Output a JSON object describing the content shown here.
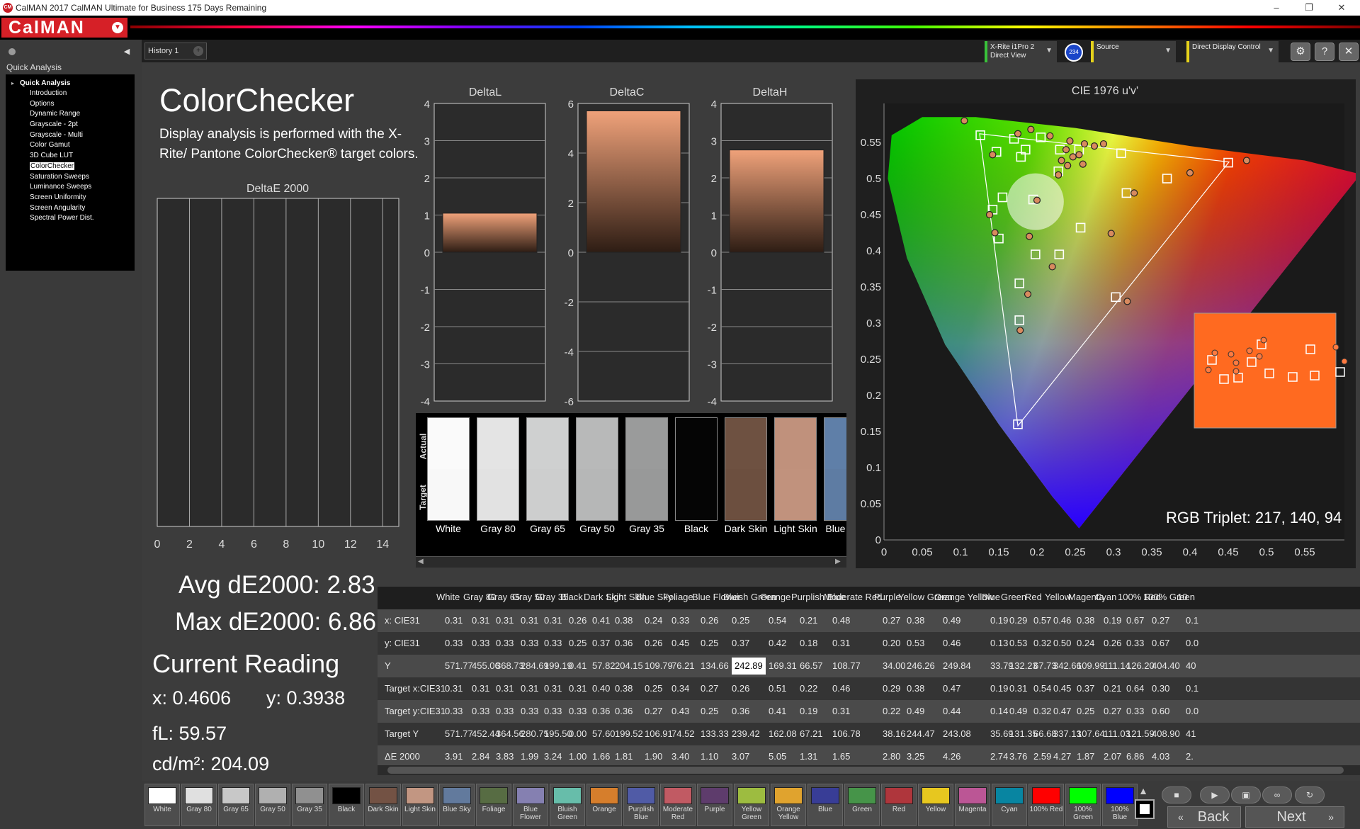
{
  "window": {
    "title": "CalMAN 2017 CalMAN Ultimate for Business 175 Days Remaining",
    "logo": "CalMAN",
    "min": "–",
    "max": "❐",
    "close": "✕"
  },
  "sidebar": {
    "label": "Quick Analysis",
    "root": "Quick Analysis",
    "items": [
      "Introduction",
      "Options",
      "Dynamic Range",
      "Grayscale - 2pt",
      "Grayscale - Multi",
      "Color Gamut",
      "3D Cube LUT",
      "ColorChecker",
      "Saturation Sweeps",
      "Luminance Sweeps",
      "Screen Uniformity",
      "Screen Angularity",
      "Spectral Power Dist."
    ],
    "selected": "ColorChecker"
  },
  "tabs": {
    "history": "History 1",
    "add": "+"
  },
  "toolbar": {
    "meter_line1": "X-Rite i1Pro 2",
    "meter_line2": "Direct View",
    "meter_badge": "234",
    "source": "Source",
    "display": "Direct Display Control",
    "icons": [
      "gear-icon",
      "help-icon",
      "close-icon"
    ]
  },
  "page": {
    "title": "ColorChecker",
    "subtitle": "Display analysis is performed with the X-Rite/ Pantone ColorChecker® target colors."
  },
  "delta_charts": {
    "deltaL": {
      "title": "DeltaL",
      "value": 1.05,
      "ticks": [
        "4",
        "3",
        "2",
        "1",
        "0",
        "-1",
        "-2",
        "-3",
        "-4"
      ],
      "max": 4,
      "min": -4
    },
    "deltaC": {
      "title": "DeltaC",
      "value": 5.7,
      "ticks": [
        "6",
        "4",
        "2",
        "0",
        "-2",
        "-4",
        "-6"
      ],
      "max": 6,
      "min": -6
    },
    "deltaH": {
      "title": "DeltaH",
      "value": 2.75,
      "ticks": [
        "4",
        "3",
        "2",
        "1",
        "0",
        "-1",
        "-2",
        "-3",
        "-4"
      ],
      "max": 4,
      "min": -4
    }
  },
  "de_chart": {
    "title": "DeltaE 2000",
    "ticks": [
      "0",
      "2",
      "4",
      "6",
      "8",
      "10",
      "12",
      "14"
    ],
    "max": 15
  },
  "swatches": {
    "actual_label": "Actual",
    "target_label": "Target",
    "items": [
      {
        "name": "White",
        "actual": "#fafafa",
        "target": "#f8f8f8"
      },
      {
        "name": "Gray 80",
        "actual": "#e4e4e4",
        "target": "#e2e2e2"
      },
      {
        "name": "Gray 65",
        "actual": "#cfd0d0",
        "target": "#cdcece"
      },
      {
        "name": "Gray 50",
        "actual": "#b8b9b9",
        "target": "#b6b7b7"
      },
      {
        "name": "Gray 35",
        "actual": "#9a9b9b",
        "target": "#989999"
      },
      {
        "name": "Black",
        "actual": "#050505",
        "target": "#050505"
      },
      {
        "name": "Dark Skin",
        "actual": "#6e5141",
        "target": "#6c4f3f"
      },
      {
        "name": "Light Skin",
        "actual": "#c0917c",
        "target": "#c1927d"
      },
      {
        "name": "Blue Sky",
        "actual": "#5f7fa8",
        "target": "#5e7ca3"
      }
    ]
  },
  "cie": {
    "title": "CIE 1976 u'v'",
    "x_ticks": [
      "0",
      "0.05",
      "0.1",
      "0.15",
      "0.2",
      "0.25",
      "0.3",
      "0.35",
      "0.4",
      "0.45",
      "0.5",
      "0.55"
    ],
    "y_ticks": [
      "0",
      "0.05",
      "0.1",
      "0.15",
      "0.2",
      "0.25",
      "0.3",
      "0.35",
      "0.4",
      "0.45",
      "0.5",
      "0.55"
    ],
    "rgb_triplet": "RGB Triplet: 217, 140, 94"
  },
  "stats": {
    "avg": "Avg dE2000: 2.83",
    "max": "Max dE2000: 6.86",
    "current_title": "Current Reading",
    "x": "x: 0.4606",
    "y": "y: 0.3938",
    "fl": "fL: 59.57",
    "cd": "cd/m²: 204.09"
  },
  "table": {
    "columns": [
      "White",
      "Gray 80",
      "Gray 65",
      "Gray 50",
      "Gray 35",
      "Black",
      "Dark Skin",
      "Light Skin",
      "Blue Sky",
      "Foliage",
      "Blue Flower",
      "Bluish Green",
      "Orange",
      "Purplish Blue",
      "Moderate Red",
      "Purple",
      "Yellow Green",
      "Orange Yellow",
      "Blue",
      "Green",
      "Red",
      "Yellow",
      "Magenta",
      "Cyan",
      "100% Red",
      "100% Green",
      "10"
    ],
    "rows": [
      {
        "label": "x: CIE31",
        "values": [
          "0.31",
          "0.31",
          "0.31",
          "0.31",
          "0.31",
          "0.26",
          "0.41",
          "0.38",
          "0.24",
          "0.33",
          "0.26",
          "0.25",
          "0.54",
          "0.21",
          "0.48",
          "0.27",
          "0.38",
          "0.49",
          "0.19",
          "0.29",
          "0.57",
          "0.46",
          "0.38",
          "0.19",
          "0.67",
          "0.27",
          "0.1"
        ]
      },
      {
        "label": "y: CIE31",
        "values": [
          "0.33",
          "0.33",
          "0.33",
          "0.33",
          "0.33",
          "0.25",
          "0.37",
          "0.36",
          "0.26",
          "0.45",
          "0.25",
          "0.37",
          "0.42",
          "0.18",
          "0.31",
          "0.20",
          "0.53",
          "0.46",
          "0.13",
          "0.53",
          "0.32",
          "0.50",
          "0.24",
          "0.26",
          "0.33",
          "0.67",
          "0.0"
        ]
      },
      {
        "label": "Y",
        "values": [
          "571.77",
          "455.06",
          "368.73",
          "284.69",
          "199.19",
          "0.41",
          "57.82",
          "204.15",
          "109.79",
          "76.21",
          "134.66",
          "242.89",
          "169.31",
          "66.57",
          "108.77",
          "34.00",
          "246.26",
          "249.84",
          "33.79",
          "132.23",
          "67.73",
          "342.66",
          "109.99",
          "111.14",
          "126.20",
          "404.40",
          "40"
        ]
      },
      {
        "label": "Target x:CIE31",
        "values": [
          "0.31",
          "0.31",
          "0.31",
          "0.31",
          "0.31",
          "0.31",
          "0.40",
          "0.38",
          "0.25",
          "0.34",
          "0.27",
          "0.26",
          "0.51",
          "0.22",
          "0.46",
          "0.29",
          "0.38",
          "0.47",
          "0.19",
          "0.31",
          "0.54",
          "0.45",
          "0.37",
          "0.21",
          "0.64",
          "0.30",
          "0.1"
        ]
      },
      {
        "label": "Target y:CIE31",
        "values": [
          "0.33",
          "0.33",
          "0.33",
          "0.33",
          "0.33",
          "0.33",
          "0.36",
          "0.36",
          "0.27",
          "0.43",
          "0.25",
          "0.36",
          "0.41",
          "0.19",
          "0.31",
          "0.22",
          "0.49",
          "0.44",
          "0.14",
          "0.49",
          "0.32",
          "0.47",
          "0.25",
          "0.27",
          "0.33",
          "0.60",
          "0.0"
        ]
      },
      {
        "label": "Target Y",
        "values": [
          "571.77",
          "452.44",
          "364.56",
          "280.75",
          "195.50",
          "0.00",
          "57.60",
          "199.52",
          "106.91",
          "74.52",
          "133.33",
          "239.42",
          "162.08",
          "67.21",
          "106.78",
          "38.16",
          "244.47",
          "243.08",
          "35.69",
          "131.35",
          "66.68",
          "337.13",
          "107.64",
          "111.03",
          "121.59",
          "408.90",
          "41"
        ]
      },
      {
        "label": "ΔE 2000",
        "values": [
          "3.91",
          "2.84",
          "3.83",
          "1.99",
          "3.24",
          "1.00",
          "1.66",
          "1.81",
          "1.90",
          "3.40",
          "1.10",
          "3.07",
          "5.05",
          "1.31",
          "1.65",
          "2.80",
          "3.25",
          "4.26",
          "2.74",
          "3.76",
          "2.59",
          "4.27",
          "1.87",
          "2.07",
          "6.86",
          "4.03",
          "2."
        ]
      }
    ]
  },
  "patches": [
    {
      "name": "White",
      "color": "#ffffff"
    },
    {
      "name": "Gray 80",
      "color": "#e0e0e0"
    },
    {
      "name": "Gray 65",
      "color": "#c8c8c8"
    },
    {
      "name": "Gray 50",
      "color": "#b0b0b0"
    },
    {
      "name": "Gray 35",
      "color": "#909090"
    },
    {
      "name": "Black",
      "color": "#000000"
    },
    {
      "name": "Dark Skin",
      "color": "#735244"
    },
    {
      "name": "Light Skin",
      "color": "#c29682"
    },
    {
      "name": "Blue Sky",
      "color": "#627a9d"
    },
    {
      "name": "Foliage",
      "color": "#576c43"
    },
    {
      "name": "Blue Flower",
      "color": "#8580b1"
    },
    {
      "name": "Bluish Green",
      "color": "#67bdaa"
    },
    {
      "name": "Orange",
      "color": "#d67e2c"
    },
    {
      "name": "Purplish Blue",
      "color": "#505ba6"
    },
    {
      "name": "Moderate Red",
      "color": "#c15a63"
    },
    {
      "name": "Purple",
      "color": "#5e3c6c"
    },
    {
      "name": "Yellow Green",
      "color": "#9dbc40"
    },
    {
      "name": "Orange Yellow",
      "color": "#e0a32e"
    },
    {
      "name": "Blue",
      "color": "#383d96"
    },
    {
      "name": "Green",
      "color": "#469449"
    },
    {
      "name": "Red",
      "color": "#af363c"
    },
    {
      "name": "Yellow",
      "color": "#e7c71f"
    },
    {
      "name": "Magenta",
      "color": "#bb5695"
    },
    {
      "name": "Cyan",
      "color": "#0885a1"
    },
    {
      "name": "100% Red",
      "color": "#ff0000"
    },
    {
      "name": "100% Green",
      "color": "#00ff00"
    },
    {
      "name": "100% Blue",
      "color": "#0000ff"
    }
  ],
  "nav": {
    "back": "Back",
    "next": "Next"
  }
}
